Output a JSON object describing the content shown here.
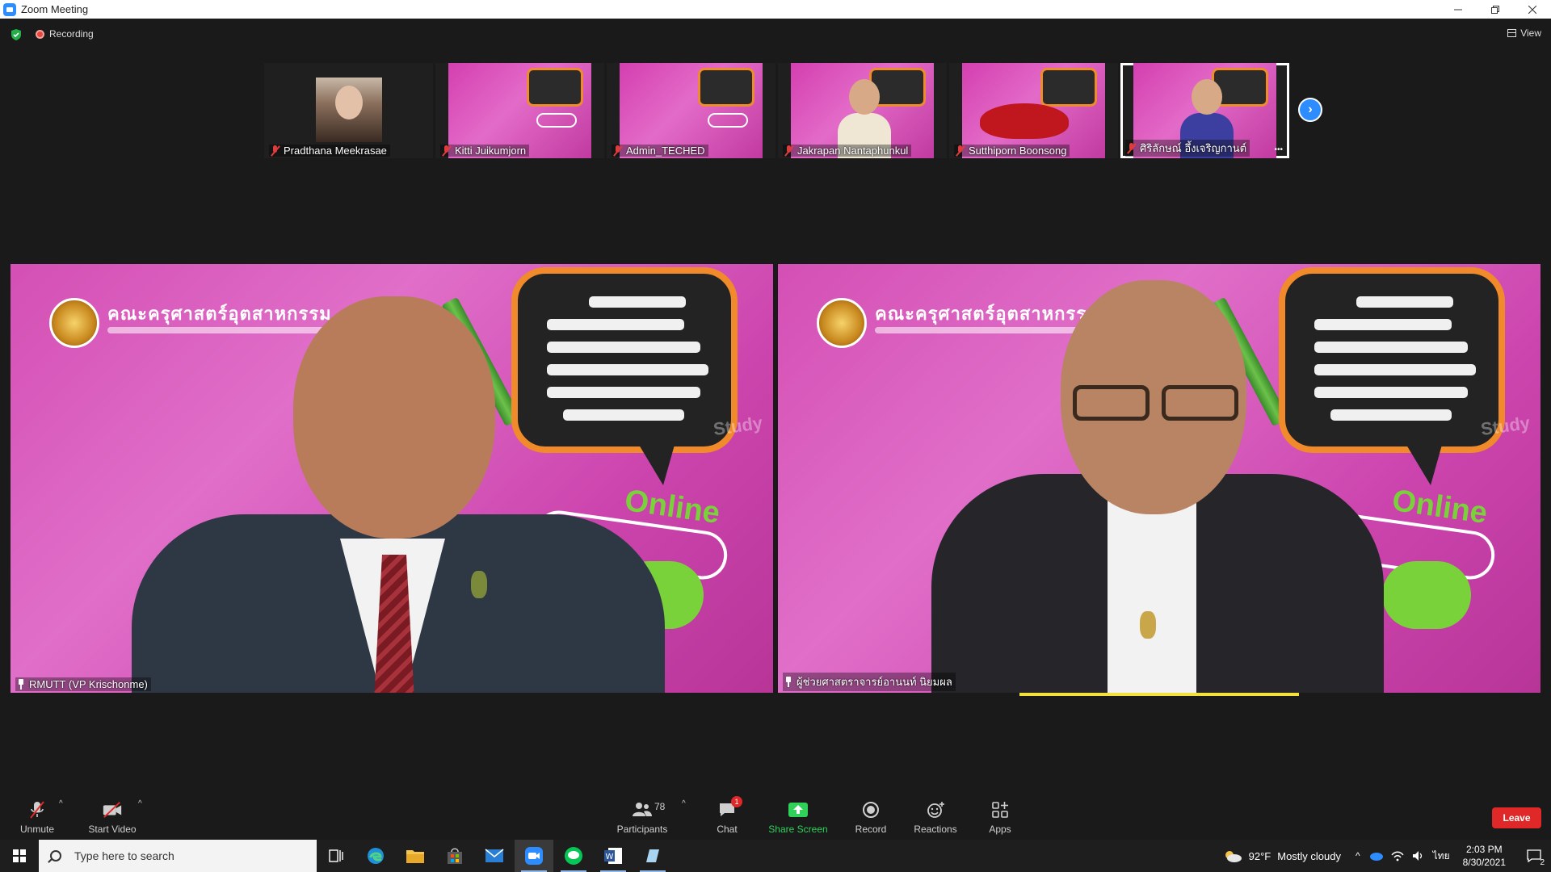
{
  "window": {
    "title": "Zoom Meeting"
  },
  "status": {
    "recording_label": "Recording",
    "view_label": "View"
  },
  "thumbnails": [
    {
      "name": "Pradthana Meekrasae"
    },
    {
      "name": "Kitti Juikumjorn"
    },
    {
      "name": "Admin_TECHED"
    },
    {
      "name": "Jakrapan Nantaphunkul"
    },
    {
      "name": "Sutthiporn Boonsong"
    },
    {
      "name": "ศิริลักษณ์ อึ้งเจริญกานต์"
    }
  ],
  "main": {
    "left_name": "RMUTT (VP Krischonme)",
    "right_name": "ผู้ช่วยศาสตราจารย์อานนท์ นิยมผล",
    "slide": {
      "org_title": "คณะครุศาสตร์อุตสาหกรรม",
      "online_label": "Online",
      "study_label": "Study"
    }
  },
  "toolbar": {
    "unmute": "Unmute",
    "start_video": "Start Video",
    "participants": "Participants",
    "participants_count": "78",
    "chat": "Chat",
    "chat_badge": "1",
    "share_screen": "Share Screen",
    "record": "Record",
    "reactions": "Reactions",
    "apps": "Apps",
    "leave": "Leave"
  },
  "taskbar": {
    "search_placeholder": "Type here to search",
    "weather_temp": "92°F",
    "weather_text": "Mostly cloudy",
    "lang": "ไทย",
    "time": "2:03 PM",
    "date": "8/30/2021",
    "notification_count": "2"
  },
  "colors": {
    "zoom_blue": "#2d8cff",
    "leave_red": "#e02828",
    "share_green": "#2fd158",
    "slide_pink": "#d44fb4"
  }
}
